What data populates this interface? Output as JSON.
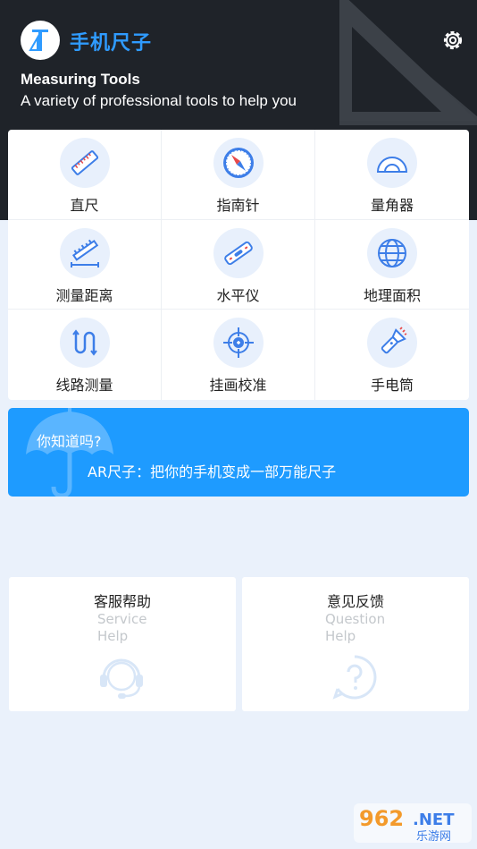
{
  "app": {
    "title": "手机尺子"
  },
  "header": {
    "title": "Measuring Tools",
    "subtitle": "A variety of professional tools to help you"
  },
  "tools": [
    {
      "label": "直尺",
      "icon": "ruler-icon"
    },
    {
      "label": "指南针",
      "icon": "compass-icon"
    },
    {
      "label": "量角器",
      "icon": "protractor-icon"
    },
    {
      "label": "测量距离",
      "icon": "distance-icon"
    },
    {
      "label": "水平仪",
      "icon": "level-icon"
    },
    {
      "label": "地理面积",
      "icon": "globe-icon"
    },
    {
      "label": "线路测量",
      "icon": "route-icon"
    },
    {
      "label": "挂画校准",
      "icon": "target-icon"
    },
    {
      "label": "手电筒",
      "icon": "flashlight-icon"
    }
  ],
  "tip": {
    "question": "你知道吗?",
    "text": "AR尺子：把你的手机变成一部万能尺子"
  },
  "cards": {
    "service": {
      "title": "客服帮助",
      "sub1": "Service",
      "sub2": "Help"
    },
    "feedback": {
      "title": "意见反馈",
      "sub1": "Question",
      "sub2": "Help"
    }
  },
  "watermark": {
    "text1": "962",
    "text2": ".NET",
    "text3": "乐游网"
  },
  "colors": {
    "accent": "#1e9bff",
    "header_bg": "#1f2329",
    "icon_blue": "#3d7ee8"
  }
}
